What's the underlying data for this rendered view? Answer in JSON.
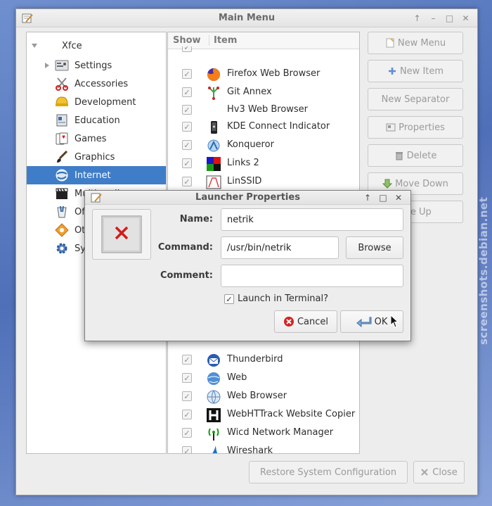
{
  "window": {
    "title": "Main Menu"
  },
  "tree": {
    "root": "Xfce",
    "items": [
      {
        "label": "Settings",
        "icon": "settings-icon"
      },
      {
        "label": "Accessories",
        "icon": "accessories-icon"
      },
      {
        "label": "Development",
        "icon": "development-icon"
      },
      {
        "label": "Education",
        "icon": "education-icon"
      },
      {
        "label": "Games",
        "icon": "games-icon"
      },
      {
        "label": "Graphics",
        "icon": "graphics-icon"
      },
      {
        "label": "Internet",
        "icon": "internet-icon"
      },
      {
        "label": "Multimedia",
        "icon": "multimedia-icon"
      },
      {
        "label": "Of",
        "icon": "office-icon"
      },
      {
        "label": "Ot",
        "icon": "other-icon"
      },
      {
        "label": "Sy",
        "icon": "system-icon"
      }
    ]
  },
  "list": {
    "col_show": "Show",
    "col_item": "Item",
    "rows_top": [
      {
        "label": "Firefox Web Browser",
        "icon": "firefox-icon"
      },
      {
        "label": "Git Annex",
        "icon": "git-annex-icon"
      },
      {
        "label": "Hv3 Web Browser",
        "icon": ""
      },
      {
        "label": "KDE Connect Indicator",
        "icon": "kdeconnect-icon"
      },
      {
        "label": "Konqueror",
        "icon": "konqueror-icon"
      },
      {
        "label": "Links 2",
        "icon": "links-icon"
      },
      {
        "label": "LinSSID",
        "icon": "linssid-icon"
      }
    ],
    "rows_bottom": [
      {
        "label": "Thunderbird",
        "icon": "thunderbird-icon"
      },
      {
        "label": "Web",
        "icon": "web-icon"
      },
      {
        "label": "Web Browser",
        "icon": "web-browser-icon"
      },
      {
        "label": "WebHTTrack Website Copier",
        "icon": "webhttrack-icon"
      },
      {
        "label": "Wicd Network Manager",
        "icon": "wicd-icon"
      },
      {
        "label": "Wireshark",
        "icon": "wireshark-icon"
      }
    ]
  },
  "side_buttons": {
    "new_menu": "New Menu",
    "new_item": "New Item",
    "new_separator": "New Separator",
    "properties": "Properties",
    "delete": "Delete",
    "move_down": "Move Down",
    "move_up": "ove Up"
  },
  "bottom": {
    "restore": "Restore System Configuration",
    "close": "Close"
  },
  "dialog": {
    "title": "Launcher Properties",
    "name_label": "Name:",
    "name_value": "netrik",
    "command_label": "Command:",
    "command_value": "/usr/bin/netrik",
    "browse": "Browse",
    "comment_label": "Comment:",
    "comment_value": "",
    "terminal_label": "Launch in Terminal?",
    "terminal_checked": true,
    "cancel": "Cancel",
    "ok": "OK"
  },
  "watermark": "screenshots.debian.net",
  "colors": {
    "selection": "#3f7dc8",
    "background": "#ededed"
  }
}
